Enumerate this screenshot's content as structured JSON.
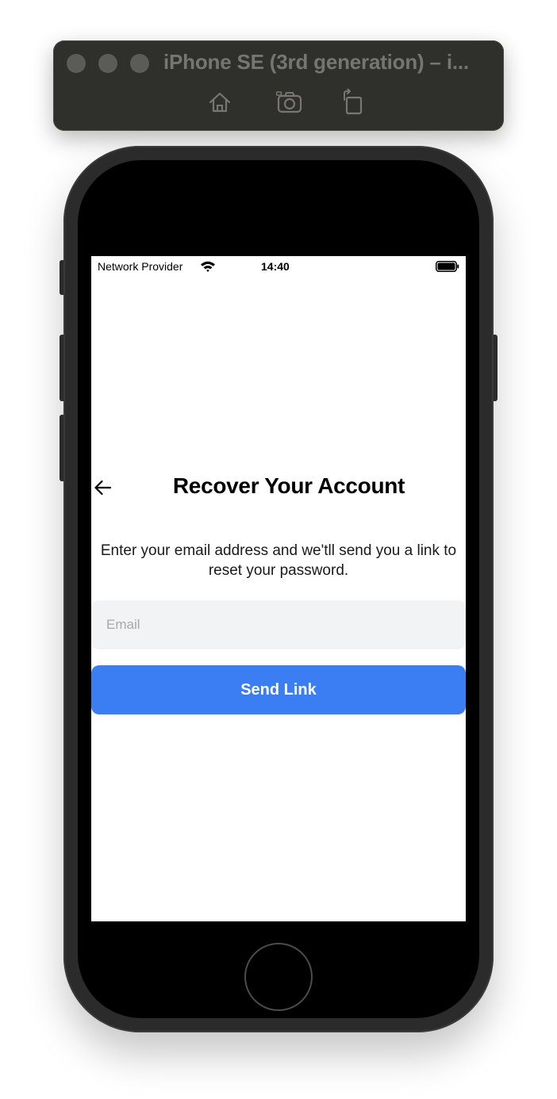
{
  "simulator": {
    "title": "iPhone SE (3rd generation) – i...",
    "toolbar": {
      "home_icon": "home-icon",
      "screenshot_icon": "camera-icon",
      "rotate_icon": "rotate-icon"
    }
  },
  "status_bar": {
    "carrier": "Network Provider",
    "time": "14:40",
    "wifi_icon": "wifi-icon",
    "battery_icon": "battery-icon"
  },
  "screen": {
    "back_icon": "arrow-left-icon",
    "title": "Recover Your Account",
    "description": "Enter your email address and we'tll send you a link to reset your password.",
    "email_input": {
      "value": "",
      "placeholder": "Email"
    },
    "send_button_label": "Send Link"
  },
  "colors": {
    "primary_button": "#3b7ef4",
    "input_background": "#f2f3f5",
    "placeholder": "#a6a8ad"
  }
}
